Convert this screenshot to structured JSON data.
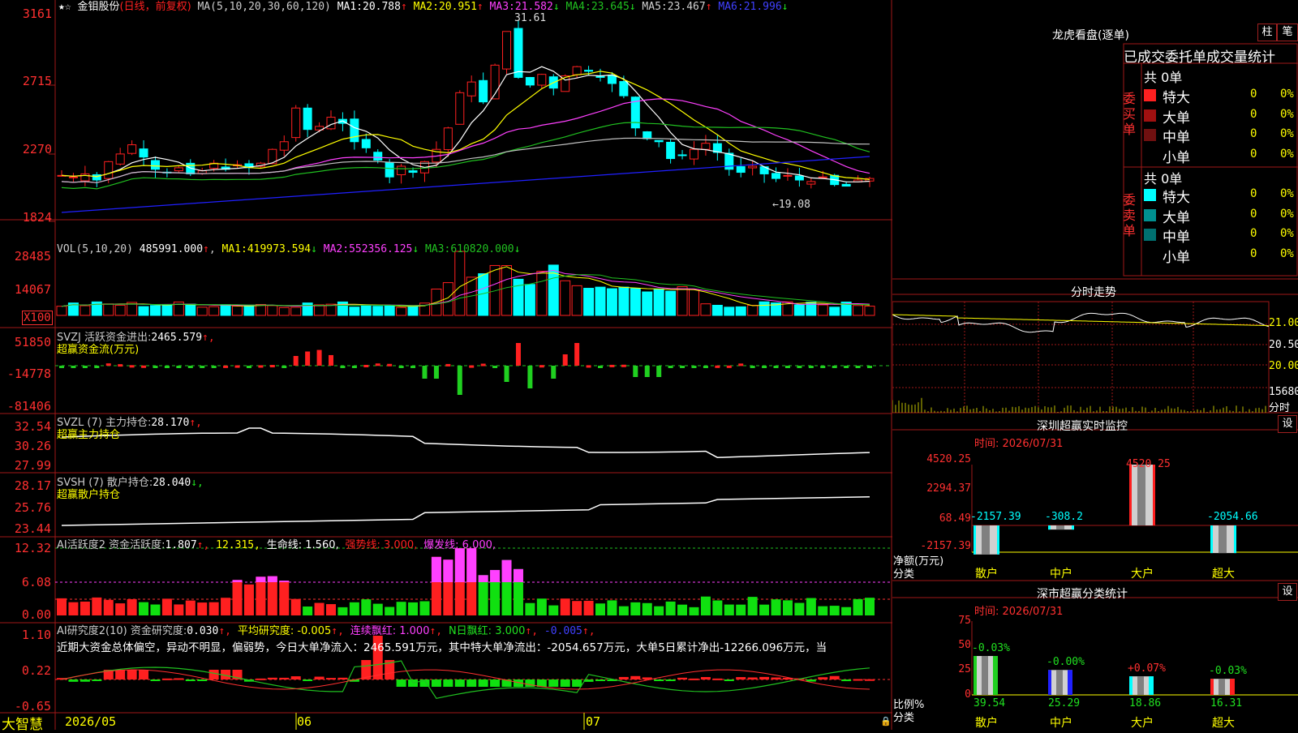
{
  "colors": {
    "up": "#ff2020",
    "down": "#00ffff",
    "grid": "#a01818",
    "white": "#ffffff",
    "yellow": "#ffff00",
    "magenta": "#ff40ff",
    "green": "#20c020",
    "blue": "#2020ff",
    "gray": "#a0a0a0"
  },
  "main": {
    "stock": "金钼股份",
    "period": "(日线，前复权)",
    "ma_label": "MA(5,10,20,30,60,120)",
    "ma": [
      {
        "name": "MA1:",
        "value": "20.788",
        "arrow": "↑",
        "color": "#ffffff"
      },
      {
        "name": "MA2:",
        "value": "20.951",
        "arrow": "↑",
        "color": "#ffff00"
      },
      {
        "name": "MA3:",
        "value": "21.582",
        "arrow": "↓",
        "color": "#ff40ff"
      },
      {
        "name": "MA4:",
        "value": "23.645",
        "arrow": "↓",
        "color": "#20c020"
      },
      {
        "name": "MA5:",
        "value": "23.467",
        "arrow": "↑",
        "color": "#d0d0d0"
      },
      {
        "name": "MA6:",
        "value": "21.996",
        "arrow": "↓",
        "color": "#4040ff"
      }
    ],
    "y_ticks": [
      "3161",
      "2715",
      "2270",
      "1824"
    ],
    "high_label": "31.61",
    "low_label": "←19.08"
  },
  "vol": {
    "label": "VOL(5,10,20)",
    "value": "485991.000",
    "arrow": "↑",
    "ma": [
      {
        "name": "MA1:",
        "value": "419973.594",
        "arrow": "↓",
        "color": "#ffff00"
      },
      {
        "name": "MA2:",
        "value": "552356.125",
        "arrow": "↓",
        "color": "#ff40ff"
      },
      {
        "name": "MA3:",
        "value": "610820.000",
        "arrow": "↓",
        "color": "#20c020"
      }
    ],
    "y_ticks": [
      "28485",
      "14067"
    ],
    "unit": "X100"
  },
  "svzj": {
    "label": "SVZJ  活跃资金进出:",
    "value": "2465.579",
    "arrow": "↑,",
    "sub": "超赢资金流(万元)",
    "y_ticks": [
      "51850",
      "-14778",
      "-81406"
    ]
  },
  "svzl": {
    "label": "SVZL (7) 主力持仓:",
    "value": "28.170",
    "arrow": "↑,",
    "sub": "超赢主力持仓",
    "y_ticks": [
      "32.54",
      "30.26",
      "27.99"
    ]
  },
  "svsh": {
    "label": "SVSH (7) 散户持仓:",
    "value": "28.040",
    "arrow": "↓,",
    "sub": "超赢散户持仓",
    "y_ticks": [
      "28.17",
      "25.76",
      "23.44"
    ]
  },
  "ai1": {
    "label": "AI活跃度2 资金活跃度:",
    "value": "1.807",
    "arrow": "↑,",
    "v2": "12.315,",
    "life": "生命线: 1.560,",
    "strong": "强势线: 3.000,",
    "burst": "爆发线: 6.000,",
    "y_ticks": [
      "12.32",
      "6.08",
      "0.00"
    ]
  },
  "ai2": {
    "label": "AI研究度2(10) 资金研究度:",
    "value": "0.030",
    "arrow": "↑,",
    "avg": "平均研究度: -0.005",
    "avg_arrow": "↑,",
    "red": "连续飘红: 1.000",
    "red_arrow": "↑,",
    "nred": "N日飘红: 3.000",
    "nred_arrow": "↑,",
    "extra": "-0.005",
    "extra_arrow": "↑,",
    "comment": "近期大资金总体偏空，异动不明显，偏弱势，今日大单净流入：2465.591万元，其中特大单净流出：-2054.657万元，大单5日累计净出-12266.096万元，当",
    "y_ticks": [
      "1.10",
      "0.22",
      "-0.65"
    ]
  },
  "xaxis": {
    "brand": "大智慧",
    "labels": [
      "2026/05",
      "06",
      "07"
    ]
  },
  "dragon": {
    "title": "龙虎看盘(逐单)",
    "btn1": "柱",
    "btn2": "笔",
    "subtitle": "已成交委托单成交量统计",
    "buy": {
      "vertical": "委买单",
      "total": "共 0单",
      "rows": [
        {
          "name": "特大",
          "value": "0",
          "pct": "0%",
          "color": "#ff2020"
        },
        {
          "name": "大单",
          "value": "0",
          "pct": "0%",
          "color": "#a01010"
        },
        {
          "name": "中单",
          "value": "0",
          "pct": "0%",
          "color": "#701010"
        },
        {
          "name": "小单",
          "value": "0",
          "pct": "0%",
          "color": "#000000"
        }
      ]
    },
    "sell": {
      "vertical": "委卖单",
      "total": "共 0单",
      "rows": [
        {
          "name": "特大",
          "value": "0",
          "pct": "0%",
          "color": "#00ffff"
        },
        {
          "name": "大单",
          "value": "0",
          "pct": "0%",
          "color": "#009090"
        },
        {
          "name": "中单",
          "value": "0",
          "pct": "0%",
          "color": "#007070"
        },
        {
          "name": "小单",
          "value": "0",
          "pct": "0%",
          "color": "#000000"
        }
      ]
    }
  },
  "intraday": {
    "title": "分时走势",
    "y_ticks": [
      "21.00",
      "20.50",
      "20.00",
      "15680"
    ],
    "unit": "分时"
  },
  "sz_monitor": {
    "title": "深圳超赢实时监控",
    "btn": "设",
    "time": "时间: 2026/07/31",
    "y_ticks": [
      "4520.25",
      "2294.37",
      "68.49",
      "-2157.39"
    ],
    "axis_label": "净额(万元)",
    "cat_label": "分类",
    "bars": [
      {
        "cat": "散户",
        "value": -2157.39,
        "label": "-2157.39",
        "color": "#00ffff"
      },
      {
        "cat": "中户",
        "value": -308.2,
        "label": "-308.2",
        "color": "#00ffff"
      },
      {
        "cat": "大户",
        "value": 4520.25,
        "label": "4520.25",
        "color": "#ff2020"
      },
      {
        "cat": "超大",
        "value": -2054.66,
        "label": "-2054.66",
        "color": "#00ffff"
      }
    ]
  },
  "sz_class": {
    "title": "深市超赢分类统计",
    "btn": "设",
    "time": "时间: 2026/07/31",
    "y_ticks": [
      "75",
      "50",
      "25",
      "0"
    ],
    "axis_label": "比例%",
    "cat_label": "分类",
    "bars": [
      {
        "cat": "散户",
        "value": 39.54,
        "label": "39.54",
        "delta": "-0.03%",
        "color": "#20d020"
      },
      {
        "cat": "中户",
        "value": 25.29,
        "label": "25.29",
        "delta": "-0.00%",
        "color": "#2020ff"
      },
      {
        "cat": "大户",
        "value": 18.86,
        "label": "18.86",
        "delta": "+0.07%",
        "color": "#00ffff"
      },
      {
        "cat": "超大",
        "value": 16.31,
        "label": "16.31",
        "delta": "-0.03%",
        "color": "#ff2020"
      }
    ]
  }
}
